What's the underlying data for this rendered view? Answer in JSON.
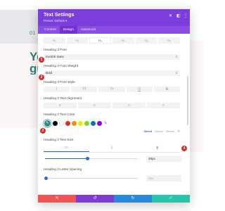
{
  "background": {
    "number_label": "01",
    "heading": "Yo\ngu"
  },
  "modal": {
    "title": "Text Settings",
    "preset": "Preset: Default ▾",
    "tabs": [
      "Content",
      "Design",
      "Advanced"
    ],
    "header_icons": [
      "close-icon",
      "split-icon",
      "more-icon"
    ]
  },
  "heading_tabs": [
    "H₁",
    "H₂",
    "H₃",
    "H₄",
    "H₅",
    "H₆"
  ],
  "fields": {
    "font_label": "Heading 3 Font",
    "font_value": "Kumbh Sans",
    "weight_label": "Heading 3 Font Weight",
    "weight_value": "Bold",
    "style_label": "Heading 3 Font Style",
    "style_buttons": [
      "I",
      "TT",
      "Tт",
      "U",
      "S"
    ],
    "align_label": "Heading 3 Text Alignment",
    "align_buttons": [
      "≡",
      "≡",
      "≡",
      "≡"
    ],
    "color_label": "Heading 3 Text Color",
    "color_tabs": [
      "Saved",
      "Global",
      "Recent"
    ],
    "size_label": "Heading 3 Text Size",
    "size_value": "48px",
    "size_fraction": 0.46,
    "spacing_label": "Heading 3 Letter Spacing",
    "spacing_value": "0px",
    "spacing_fraction": 0.0
  },
  "swatches": [
    "#000000",
    "#ffffff",
    "#e02b20",
    "#e09900",
    "#edf000",
    "#7cda24",
    "#0c71c3",
    "#8300e9"
  ],
  "selected_color": "#2b8a82",
  "markers": [
    "1",
    "2",
    "3",
    "4"
  ],
  "footer": {
    "cancel": "✕",
    "undo": "↺",
    "redo": "↻",
    "save": "✓",
    "colors": {
      "cancel": "#ef5555",
      "undo": "#7e3bd0",
      "redo": "#2b87da",
      "save": "#29c4a9"
    }
  },
  "colors": {
    "header": "#7b3ddb",
    "tabs": "#8b4ee2",
    "accent": "#2a6fc7",
    "marker": "#d32f2f"
  }
}
